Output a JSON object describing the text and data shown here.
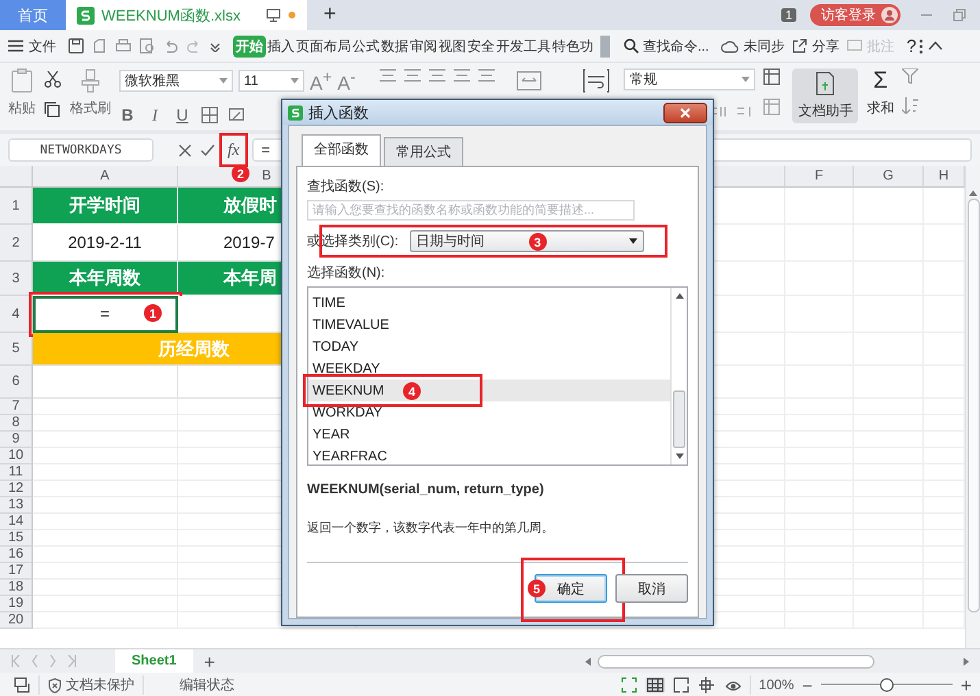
{
  "tabs": [
    {
      "label": "首页",
      "kind": "home",
      "selected": false
    },
    {
      "label": "WEEKNUM函数.xlsx",
      "kind": "file",
      "selected": true
    }
  ],
  "new_tab": "+",
  "page_count": "1",
  "login": "访客登录",
  "menu": {
    "file": "文件",
    "tabs": [
      {
        "label": "开始",
        "selected": true
      },
      {
        "label": "插入",
        "selected": false
      },
      {
        "label": "页面布局",
        "selected": false
      },
      {
        "label": "公式",
        "selected": false
      },
      {
        "label": "数据",
        "selected": false
      },
      {
        "label": "审阅",
        "selected": false
      },
      {
        "label": "视图",
        "selected": false
      },
      {
        "label": "安全",
        "selected": false
      },
      {
        "label": "开发工具",
        "selected": false
      },
      {
        "label": "特色功",
        "selected": false
      }
    ],
    "search": "查找命令...",
    "sync": "未同步",
    "share": "分享",
    "comment": {
      "label": "批注",
      "disabled": true
    },
    "help": "?"
  },
  "ribbon": {
    "paste": "粘贴",
    "format_painter": "格式刷",
    "font": "微软雅黑",
    "font_size": "11",
    "grow_font": "A$^{+}$",
    "shrink_font": "A$^{-}$",
    "styles": [
      "B",
      "I",
      "U"
    ],
    "number_format": "常规",
    "assistant": "文档助手",
    "sum_symbol": "Σ",
    "sum": "求和"
  },
  "formula_bar": {
    "name_box": "NETWORKDAYS",
    "fx": "fx",
    "formula": "=",
    "annotation": "2"
  },
  "sheet": {
    "columns": [
      "A",
      "B",
      "F",
      "G",
      "H"
    ],
    "rows": [
      {
        "number": "1",
        "cells": [
          {
            "text": "开学时间",
            "kind": "header",
            "selected": false
          },
          {
            "text": "放假时",
            "kind": "header",
            "selected": false
          }
        ]
      },
      {
        "number": "2",
        "cells": [
          {
            "text": "2019-2-11",
            "kind": "value",
            "selected": false
          },
          {
            "text": "2019-7",
            "kind": "value",
            "selected": false
          }
        ]
      },
      {
        "number": "3",
        "cells": [
          {
            "text": "本年周数",
            "kind": "header",
            "selected": false
          },
          {
            "text": "本年周",
            "kind": "header",
            "selected": false
          }
        ]
      },
      {
        "number": "4",
        "cells": [
          {
            "text": "=",
            "kind": "value",
            "selected": true,
            "annotation": "1"
          },
          {
            "kind": "value",
            "selected": false
          }
        ]
      },
      {
        "number": "5",
        "cells": [
          {
            "text": "历经周数",
            "kind": "total",
            "merged": true,
            "selected": false
          }
        ]
      },
      {
        "number": "6",
        "cells": [
          {
            "kind": "value",
            "selected": false
          },
          {
            "kind": "value",
            "selected": false
          }
        ]
      },
      {
        "number": "7"
      },
      {
        "number": "8"
      },
      {
        "number": "9"
      },
      {
        "number": "10"
      },
      {
        "number": "11"
      },
      {
        "number": "12"
      },
      {
        "number": "13"
      },
      {
        "number": "14"
      },
      {
        "number": "15"
      },
      {
        "number": "16"
      },
      {
        "number": "17"
      },
      {
        "number": "18"
      },
      {
        "number": "19"
      },
      {
        "number": "20"
      }
    ]
  },
  "sheet_tabs": [
    {
      "label": "Sheet1",
      "selected": true
    }
  ],
  "add_sheet": "+",
  "status_bar": {
    "protection": "文档未保护",
    "mode": "编辑状态",
    "zoom": "100%",
    "zoom_slider": {
      "level": 0.5
    },
    "zoom_out": "−",
    "zoom_in": "+"
  },
  "dialog": {
    "title": "插入函数",
    "tabs": [
      {
        "label": "全部函数",
        "selected": true
      },
      {
        "label": "常用公式",
        "selected": false
      }
    ],
    "search_label": "查找函数(S):",
    "placeholder": "请输入您要查找的函数名称或函数功能的简要描述...",
    "category_label": "或选择类别(C):",
    "category": "日期与时间",
    "category_annotation": "3",
    "function_label": "选择函数(N):",
    "functions": [
      {
        "name": "TIME",
        "selected": false
      },
      {
        "name": "TIMEVALUE",
        "selected": false
      },
      {
        "name": "TODAY",
        "selected": false
      },
      {
        "name": "WEEKDAY",
        "selected": false
      },
      {
        "name": "WEEKNUM",
        "selected": true,
        "annotation": "4"
      },
      {
        "name": "WORKDAY",
        "selected": false
      },
      {
        "name": "YEAR",
        "selected": false
      },
      {
        "name": "YEARFRAC",
        "selected": false
      }
    ],
    "signature": "WEEKNUM(serial_num, return_type)",
    "description": "返回一个数字，该数字代表一年中的第几周。",
    "buttons": [
      {
        "label": "确定",
        "kind": "primary",
        "annotation": "5"
      },
      {
        "label": "取消",
        "kind": "secondary"
      }
    ]
  }
}
